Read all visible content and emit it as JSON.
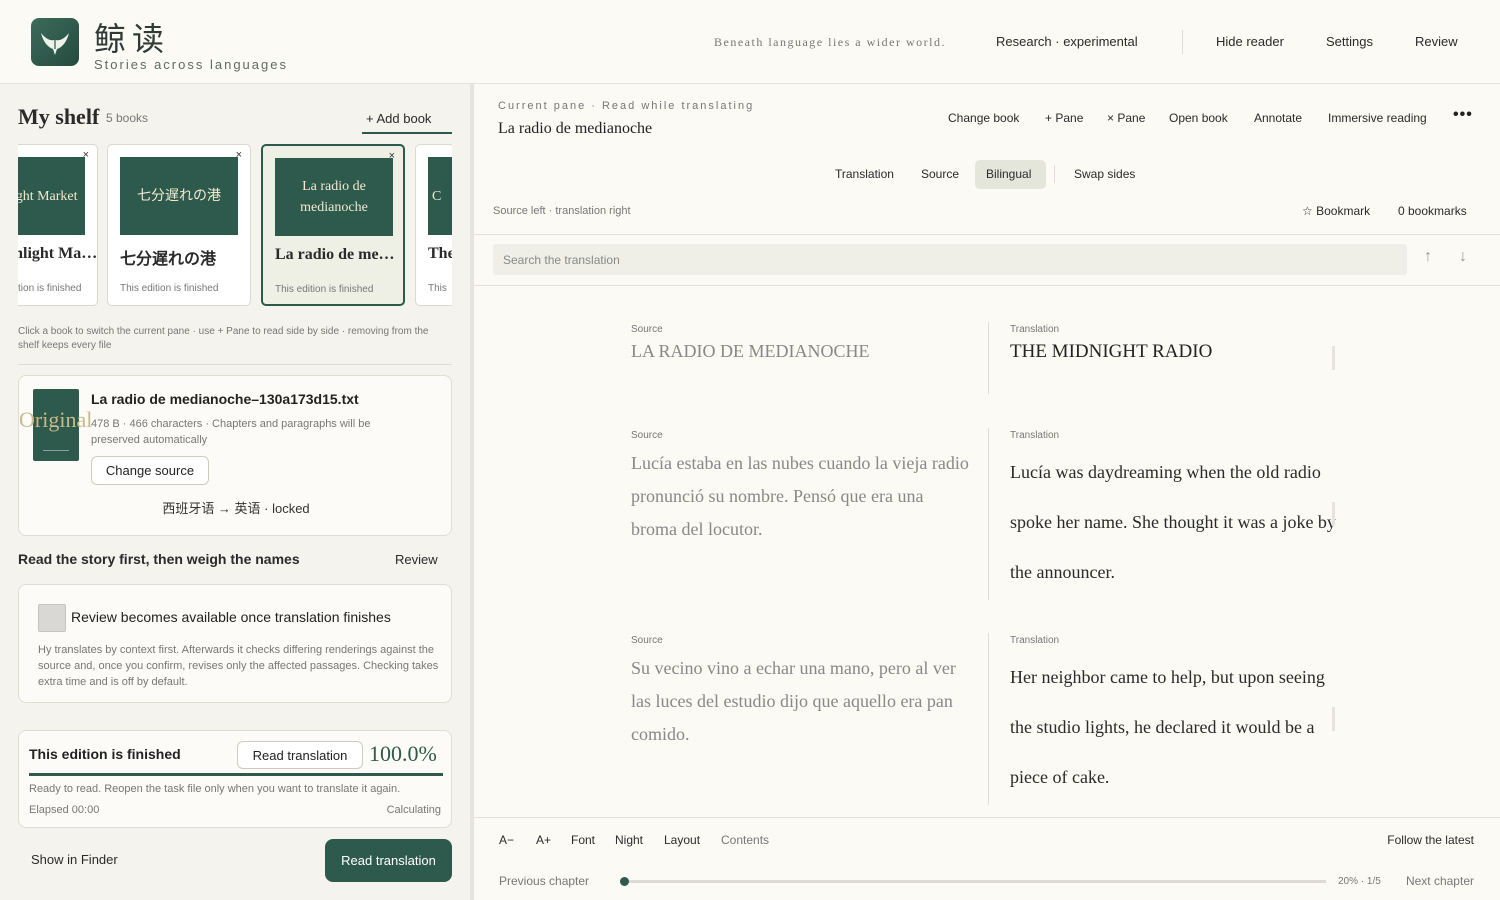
{
  "app": {
    "title": "鲸读",
    "subtitle": "Stories across languages",
    "tagline": "Beneath language lies a wider world.",
    "nav": {
      "research": "Research · experimental",
      "hide_reader": "Hide reader",
      "settings": "Settings",
      "review": "Review"
    }
  },
  "shelf": {
    "title": "My shelf",
    "count": "5 books",
    "add_label": "+ Add book",
    "books": [
      {
        "cover": "Moonlight Market",
        "title": "Moonlight Market",
        "status": "This edition is finished"
      },
      {
        "cover": "七分遅れの港",
        "title": "七分遅れの港",
        "status": "This edition is finished"
      },
      {
        "cover": "La radio de medianoche",
        "title": "La radio de medianoche",
        "status": "This edition is finished",
        "active": true
      },
      {
        "cover": "C",
        "title": "The",
        "status": "This"
      }
    ],
    "close_glyph": "×",
    "hint": "Click a book to switch the current pane · use + Pane to read side by side · removing from the shelf keeps every file"
  },
  "file": {
    "thumb_text": "Original",
    "name": "La radio de medianoche–130a173d15.txt",
    "meta": "478 B · 466 characters · Chapters and paragraphs will be preserved automatically",
    "change_source": "Change source",
    "lang_lock": "西班牙语 → 英语 · locked"
  },
  "review": {
    "heading": "Read the story first, then weigh the names",
    "link": "Review",
    "title": "Review becomes available once translation finishes",
    "desc": "Hy translates by context first. Afterwards it checks differing renderings against the source and, once you confirm, revises only the affected passages. Checking takes extra time and is off by default."
  },
  "status": {
    "title": "This edition is finished",
    "read_btn": "Read translation",
    "percent_text": "100.0%",
    "progress": 1.0,
    "desc": "Ready to read. Reopen the task file only when you want to translate it again.",
    "elapsed": "Elapsed 00:00",
    "calc": "Calculating"
  },
  "bottom": {
    "finder": "Show in Finder",
    "read_translation": "Read translation"
  },
  "reader": {
    "caption": "Current pane · Read while translating",
    "title": "La radio de medianoche",
    "toolbar": {
      "change_book": "Change book",
      "add_pane": "+ Pane",
      "remove_pane": "× Pane",
      "open_book": "Open book",
      "annotate": "Annotate",
      "immersive": "Immersive reading",
      "more": "•••"
    },
    "modes": {
      "translation": "Translation",
      "source": "Source",
      "bilingual": "Bilingual",
      "swap": "Swap sides"
    },
    "layout_label": "Source left · translation right",
    "bookmark": "☆ Bookmark",
    "bookmarks_count": "0 bookmarks",
    "search_placeholder": "Search the translation",
    "up_arrow": "↑",
    "down_arrow": "↓",
    "source_cap": "Source",
    "translation_cap": "Translation",
    "paragraphs": [
      {
        "source": "LA RADIO DE MEDIANOCHE",
        "translation": "THE MIDNIGHT RADIO"
      },
      {
        "source": "Lucía estaba en las nubes cuando la vieja radio pronunció su nombre. Pensó que era una broma del locutor.",
        "translation": "Lucía was daydreaming when the old radio spoke her name. She thought it was a joke by the announcer."
      },
      {
        "source": "Su vecino vino a echar una mano, pero al ver las luces del estudio dijo que aquello era pan comido.",
        "translation": "Her neighbor came to help, but upon seeing the studio lights, he declared it would be a piece of cake."
      }
    ],
    "footer": {
      "a_minus": "A−",
      "a_plus": "A+",
      "font": "Font",
      "night": "Night",
      "layout": "Layout",
      "contents": "Contents",
      "follow": "Follow the latest",
      "prev": "Previous chapter",
      "next": "Next chapter",
      "position": "20% · 1/5",
      "position_fraction": 0.0
    }
  },
  "colors": {
    "accent": "#2d5a4c",
    "cover_text": "#f3e9cf",
    "page_bg": "#f4f3ee"
  }
}
